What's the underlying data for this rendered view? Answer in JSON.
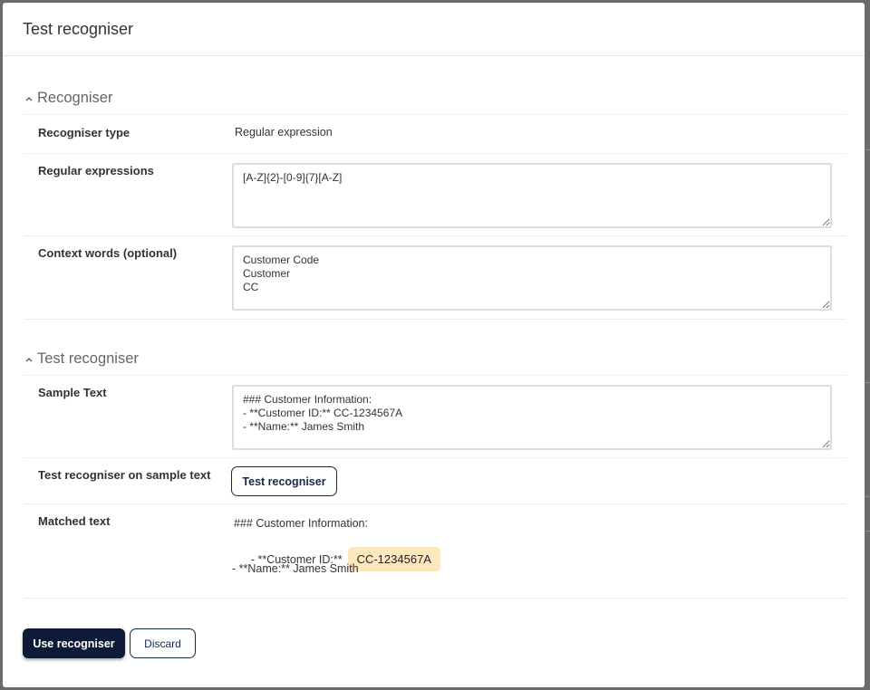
{
  "dialog": {
    "title": "Test recogniser"
  },
  "recogniser_section": {
    "title": "Recogniser",
    "type_label": "Recogniser type",
    "type_value": "Regular expression",
    "regex_label": "Regular expressions",
    "regex_value": "[A-Z]{2}-[0-9]{7}[A-Z]",
    "context_label": "Context words (optional)",
    "context_value": "Customer Code\nCustomer\nCC"
  },
  "test_section": {
    "title": "Test recogniser",
    "sample_label": "Sample Text",
    "sample_value": "### Customer Information:\n- **Customer ID:** CC-1234567A\n- **Name:** James Smith",
    "test_label": "Test recogniser on sample text",
    "test_button": "Test recogniser",
    "matched_label": "Matched text",
    "matched": {
      "line1": "### Customer Information:",
      "line2_prefix": "- **Customer ID:**",
      "line2_match": "CC-1234567A",
      "line3": "- **Name:** James Smith"
    }
  },
  "footer": {
    "use_button": "Use recogniser",
    "discard_button": "Discard"
  },
  "icons": {
    "section_toggle": "chevron-up-icon"
  },
  "colors": {
    "primary": "#0e1b38",
    "highlight": "#fde7bd",
    "outline": "#132a4a"
  }
}
